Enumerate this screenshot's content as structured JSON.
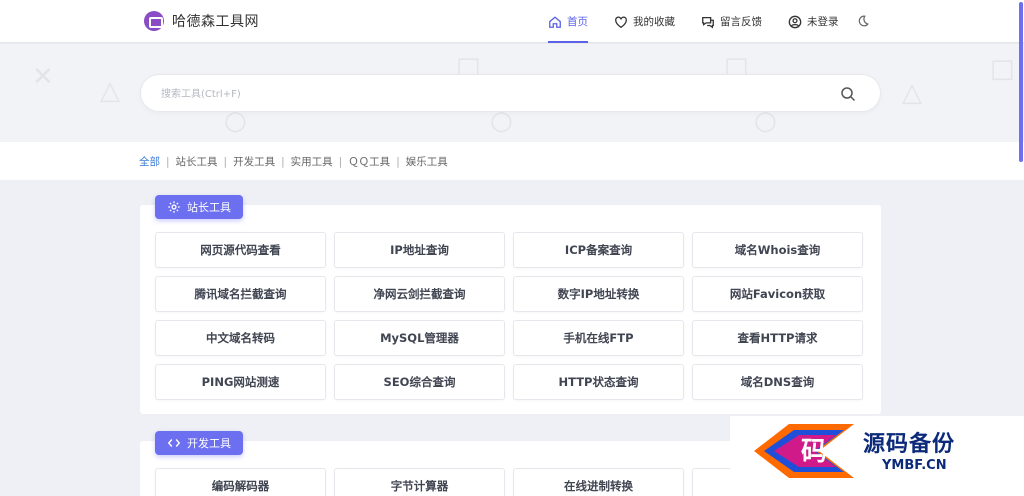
{
  "header": {
    "site_name": "哈德森工具网",
    "nav": [
      {
        "label": "首页",
        "icon": "home-icon",
        "active": true
      },
      {
        "label": "我的收藏",
        "icon": "heart-icon",
        "active": false
      },
      {
        "label": "留言反馈",
        "icon": "chat-icon",
        "active": false
      },
      {
        "label": "未登录",
        "icon": "user-icon",
        "active": false
      }
    ],
    "theme_icon": "moon-icon"
  },
  "search": {
    "placeholder": "搜索工具(Ctrl+F)"
  },
  "categories": {
    "items": [
      "全部",
      "站长工具",
      "开发工具",
      "实用工具",
      "ＱＱ工具",
      "娱乐工具"
    ],
    "active": "全部",
    "separator": "|"
  },
  "sections": [
    {
      "title": "站长工具",
      "icon": "gear-icon",
      "tools": [
        "网页源代码查看",
        "IP地址查询",
        "ICP备案查询",
        "域名Whois查询",
        "腾讯域名拦截查询",
        "净网云剑拦截查询",
        "数字IP地址转换",
        "网站Favicon获取",
        "中文域名转码",
        "MySQL管理器",
        "手机在线FTP",
        "查看HTTP请求",
        "PING网站测速",
        "SEO综合查询",
        "HTTP状态查询",
        "域名DNS查询"
      ]
    },
    {
      "title": "开发工具",
      "icon": "code-icon",
      "tools": [
        "编码解码器",
        "字节计算器",
        "在线进制转换",
        ""
      ]
    }
  ],
  "watermark": {
    "brand": "源码备份",
    "url": "YMBF.CN",
    "logo_char": "码"
  },
  "colors": {
    "accent": "#6c6ff0",
    "link_active": "#3d7dd8",
    "nav_active": "#5b62e8"
  }
}
